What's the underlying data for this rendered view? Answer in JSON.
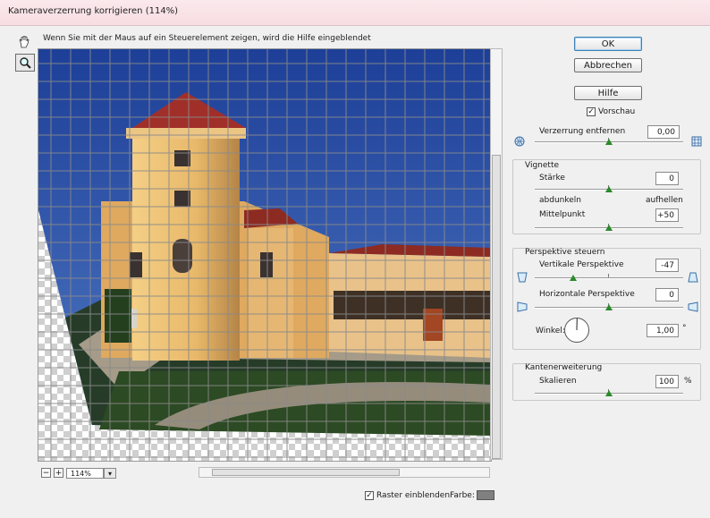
{
  "window": {
    "title": "Kameraverzerrung korrigieren (114%)"
  },
  "hint": "Wenn Sie mit der Maus auf ein Steuerelement zeigen, wird die Hilfe eingeblendet",
  "tools": [
    {
      "icon": "hand-icon"
    },
    {
      "icon": "zoom-icon"
    }
  ],
  "buttons": {
    "ok": "OK",
    "cancel": "Abbrechen",
    "help": "Hilfe"
  },
  "preview_checkbox": {
    "label": "Vorschau",
    "checked": true
  },
  "distortion": {
    "label": "Verzerrung entfernen",
    "value": "0,00",
    "slider_fraction": 0.5
  },
  "vignette": {
    "title": "Vignette",
    "strength_label": "Stärke",
    "strength_value": "0",
    "strength_fraction": 0.5,
    "darken_label": "abdunkeln",
    "lighten_label": "aufhellen",
    "midpoint_label": "Mittelpunkt",
    "midpoint_value": "+50",
    "midpoint_fraction": 0.5
  },
  "perspective": {
    "title": "Perspektive steuern",
    "vertical_label": "Vertikale Perspektive",
    "vertical_value": "-47",
    "vertical_fraction": 0.265,
    "horizontal_label": "Horizontale Perspektive",
    "horizontal_value": "0",
    "horizontal_fraction": 0.5,
    "angle_label": "Winkel:",
    "angle_value": "1,00",
    "angle_unit": "°"
  },
  "edge": {
    "title": "Kantenerweiterung",
    "scale_label": "Skalieren",
    "scale_value": "100",
    "scale_unit": "%",
    "scale_fraction": 0.5
  },
  "zoom": {
    "value": "114%"
  },
  "grid": {
    "label": "Raster einblenden",
    "checked": true,
    "color_label": "Farbe:",
    "color": "#808080"
  }
}
